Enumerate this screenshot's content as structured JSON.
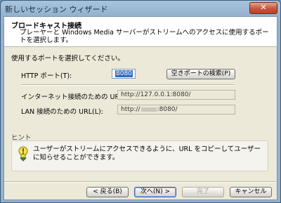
{
  "window": {
    "title": "新しいセッション ウィザード",
    "close_glyph": "✕"
  },
  "header": {
    "title": "ブロードキャスト接続",
    "subtitle": "プレーヤーと Windows Media サーバーがストリームへのアクセスに使用するポートを選択します。"
  },
  "main": {
    "instruction": "使用するポートを選択してください。",
    "http_port_label": "HTTP ポート(T):",
    "http_port_value": "8080",
    "find_port_button": "空きポートの検索(P)",
    "internet_url_label": "インターネット接続のための URL(I):",
    "internet_url_value": "http://127.0.0.1:8080/",
    "lan_url_label": "LAN 接続のための URL(L):",
    "lan_url_prefix": "http://",
    "lan_url_suffix": ":8080/"
  },
  "hint": {
    "label": "ヒント",
    "text": "ユーザーがストリームにアクセスできるように、URL をコピーしてユーザーに知らせることができます。",
    "icon": "lightbulb-icon"
  },
  "buttons": {
    "back": "< 戻る(B)",
    "next": "次へ(N) >",
    "finish": "完了",
    "cancel": "キャンセル"
  },
  "colors": {
    "selection": "#316ac5",
    "client_bg": "#ece9d8"
  }
}
